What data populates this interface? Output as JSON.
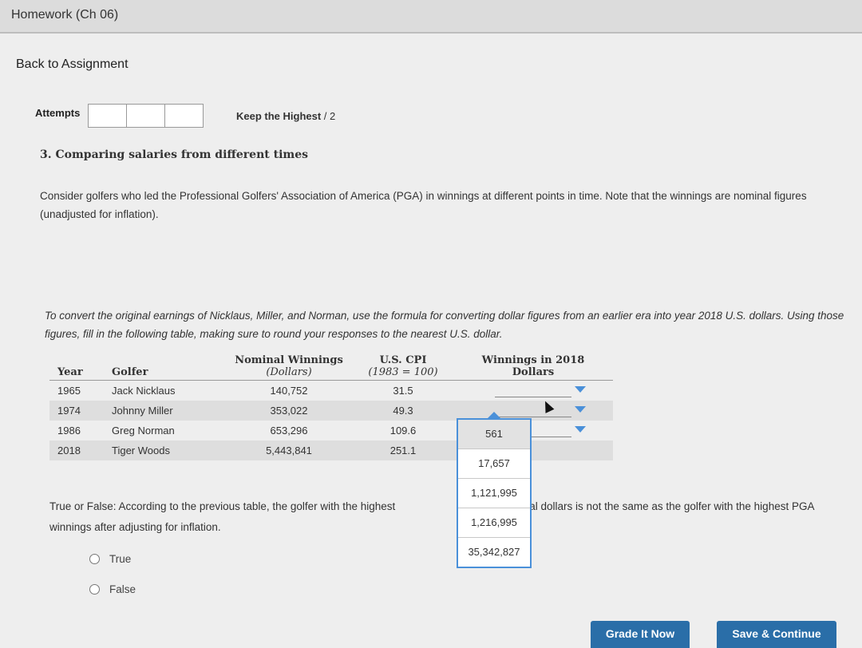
{
  "window": {
    "title": "Homework (Ch 06)"
  },
  "nav": {
    "back_label": "Back to Assignment"
  },
  "attempts": {
    "label": "Attempts",
    "keep_label": "Keep the Highest",
    "score_suffix": " / 2"
  },
  "question": {
    "title": "3. Comparing salaries from different times",
    "intro": "Consider golfers who led the Professional Golfers' Association of America (PGA) in winnings at different points in time. Note that the winnings are nominal figures (unadjusted for inflation).",
    "instructions": "To convert the original earnings of Nicklaus, Miller, and Norman, use the formula for converting dollar figures from an earlier era into year 2018 U.S. dollars. Using those figures, fill in the following table, making sure to round your responses to the nearest U.S. dollar."
  },
  "table": {
    "headers": {
      "year": "Year",
      "golfer": "Golfer",
      "nominal": "Nominal Winnings",
      "nominal_sub": "(Dollars)",
      "cpi": "U.S. CPI",
      "cpi_sub": "(1983 = 100)",
      "winnings2018": "Winnings in 2018 Dollars"
    },
    "rows": [
      {
        "year": "1965",
        "golfer": "Jack Nicklaus",
        "nominal": "140,752",
        "cpi": "31.5"
      },
      {
        "year": "1974",
        "golfer": "Johnny Miller",
        "nominal": "353,022",
        "cpi": "49.3"
      },
      {
        "year": "1986",
        "golfer": "Greg Norman",
        "nominal": "653,296",
        "cpi": "109.6"
      },
      {
        "year": "2018",
        "golfer": "Tiger Woods",
        "nominal": "5,443,841",
        "cpi": "251.1"
      }
    ]
  },
  "dropdown": {
    "options": [
      "561",
      "17,657",
      "1,121,995",
      "1,216,995",
      "35,342,827"
    ],
    "highlighted_index": 0
  },
  "true_false": {
    "question_start": "True or False: According to the previous table, the golfer with the highest",
    "question_end": "n nominal dollars is not the same as the golfer with the highest PGA winnings after adjusting for inflation.",
    "options": [
      "True",
      "False"
    ]
  },
  "buttons": {
    "grade": "Grade It Now",
    "save": "Save & Continue"
  },
  "colors": {
    "accent": "#4a90d9",
    "button": "#2a6ea8"
  }
}
